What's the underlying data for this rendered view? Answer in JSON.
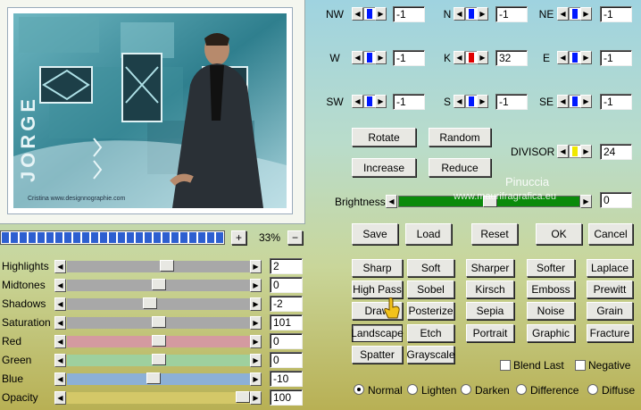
{
  "preview": {
    "vertical_text": "JORGE",
    "caption": "Cristina www.designnographie.com"
  },
  "zoom": {
    "plus": "+",
    "value": "33%",
    "minus": "−"
  },
  "adjust": [
    {
      "label": "Highlights",
      "value": "2",
      "level": 0.55,
      "color": "#a8a8a8"
    },
    {
      "label": "Midtones",
      "value": "0",
      "level": 0.5,
      "color": "#a8a8a8"
    },
    {
      "label": "Shadows",
      "value": "-2",
      "level": 0.45,
      "color": "#a8a8a8"
    },
    {
      "label": "Saturation",
      "value": "101",
      "level": 0.5,
      "color": "#a8a8a8"
    },
    {
      "label": "Red",
      "value": "0",
      "level": 0.5,
      "color": "#d49aa0"
    },
    {
      "label": "Green",
      "value": "0",
      "level": 0.5,
      "color": "#9ed09e"
    },
    {
      "label": "Blue",
      "value": "-10",
      "level": 0.47,
      "color": "#8cb0d6"
    },
    {
      "label": "Opacity",
      "value": "100",
      "level": 1.0,
      "color": "#d4c868"
    }
  ],
  "kernel": [
    {
      "label": "NW",
      "value": "-1",
      "color": "#0018ff"
    },
    {
      "label": "N",
      "value": "-1",
      "color": "#0018ff"
    },
    {
      "label": "NE",
      "value": "-1",
      "color": "#0018ff"
    },
    {
      "label": "W",
      "value": "-1",
      "color": "#0018ff"
    },
    {
      "label": "K",
      "value": "32",
      "color": "#e00000"
    },
    {
      "label": "E",
      "value": "-1",
      "color": "#0018ff"
    },
    {
      "label": "SW",
      "value": "-1",
      "color": "#0018ff"
    },
    {
      "label": "S",
      "value": "-1",
      "color": "#0018ff"
    },
    {
      "label": "SE",
      "value": "-1",
      "color": "#0018ff"
    }
  ],
  "divisor": {
    "label": "DIVISOR",
    "value": "24",
    "color": "#f0e800"
  },
  "brightness": {
    "label": "Brightness",
    "value": "0",
    "color": "#0a8a0a"
  },
  "watermark": {
    "line1": "Pinuccia",
    "line2": "www.maurifragrafica.eu"
  },
  "buttons": {
    "rotate": "Rotate",
    "random": "Random",
    "increase": "Increase",
    "reduce": "Reduce",
    "save": "Save",
    "load": "Load",
    "reset": "Reset",
    "ok": "OK",
    "cancel": "Cancel"
  },
  "presets": [
    [
      "Sharp",
      "Soft",
      "Sharper",
      "Softer",
      "Laplace"
    ],
    [
      "High Pass",
      "Sobel",
      "Kirsch",
      "Emboss",
      "Prewitt"
    ],
    [
      "Draw",
      "Posterize",
      "Sepia",
      "Noise",
      "Grain"
    ],
    [
      "Landscape",
      "Etch",
      "Portrait",
      "Graphic",
      "Fracture"
    ],
    [
      "Spatter",
      "Grayscale"
    ]
  ],
  "options": {
    "blend_last": "Blend Last",
    "negative": "Negative"
  },
  "modes": [
    "Normal",
    "Lighten",
    "Darken",
    "Difference",
    "Diffuse"
  ],
  "selected_mode": "Normal"
}
